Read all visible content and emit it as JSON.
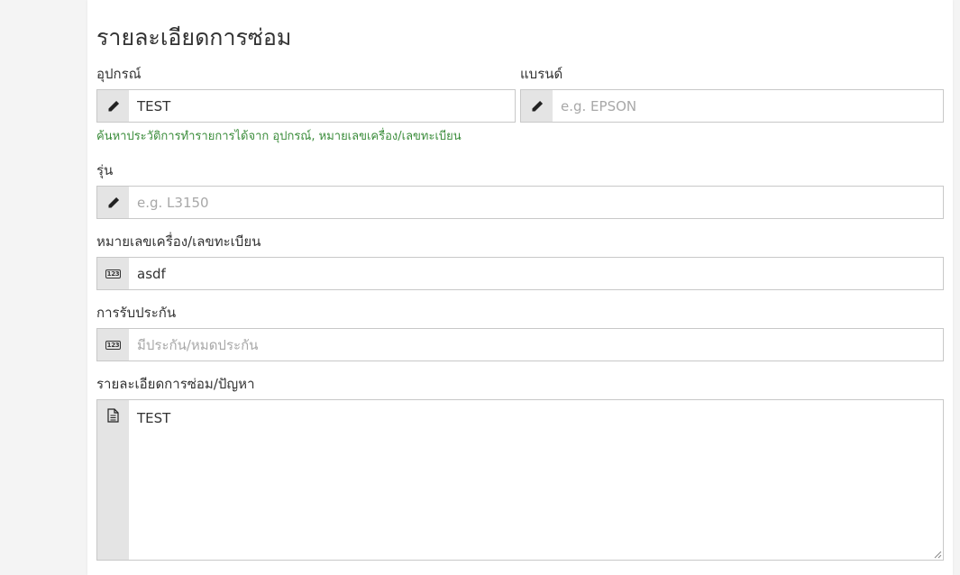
{
  "section": {
    "title": "รายละเอียดการซ่อม"
  },
  "fields": {
    "device": {
      "label": "อุปกรณ์",
      "value": "TEST",
      "icon": "pencil-icon",
      "help": "ค้นหาประวัติการทำรายการได้จาก อุปกรณ์, หมายเลขเครื่อง/เลขทะเบียน"
    },
    "brand": {
      "label": "แบรนด์",
      "value": "",
      "placeholder": "e.g. EPSON",
      "icon": "pencil-icon"
    },
    "model": {
      "label": "รุ่น",
      "value": "",
      "placeholder": "e.g. L3150",
      "icon": "pencil-icon"
    },
    "serial": {
      "label": "หมายเลขเครื่อง/เลขทะเบียน",
      "value": "asdf",
      "icon": "numbers-icon",
      "icon_text": "123"
    },
    "warranty": {
      "label": "การรับประกัน",
      "value": "",
      "placeholder": "มีประกัน/หมดประกัน",
      "icon": "numbers-icon",
      "icon_text": "123"
    },
    "problem": {
      "label": "รายละเอียดการซ่อม/ปัญหา",
      "value": "TEST",
      "icon": "document-icon"
    }
  },
  "colors": {
    "help_text": "#3c8d3c",
    "addon_bg": "#e4e4e4",
    "border": "#c8c8c8"
  }
}
